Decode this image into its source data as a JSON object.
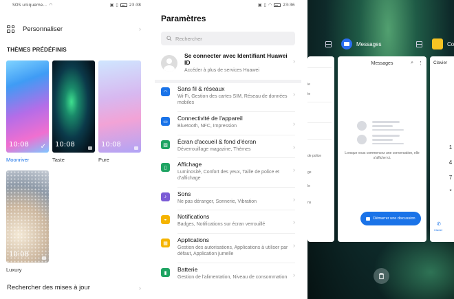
{
  "panel1": {
    "statusbar": {
      "left": "SOS uniqueme...",
      "time": "23:38"
    },
    "personalize_label": "Personnaliser",
    "themes_title": "THÈMES PRÉDÉFINIS",
    "themes": [
      {
        "name": "Moonriver",
        "clock": "10:08",
        "selected": true,
        "name_color": "#1a73e8"
      },
      {
        "name": "Taste",
        "clock": "10:08"
      },
      {
        "name": "Pure",
        "clock": "10:08"
      },
      {
        "name": "Luxury",
        "clock": "10:08"
      }
    ],
    "updates_label": "Rechercher des mises à jour"
  },
  "panel2": {
    "statusbar_time": "23:36",
    "title": "Paramètres",
    "search_placeholder": "Rechercher",
    "account": {
      "title": "Se connecter avec Identifiant Huawei ID",
      "subtitle": "Accéder à plus de services Huawei"
    },
    "items": [
      {
        "title": "Sans fil & réseaux",
        "subtitle": "Wi-Fi, Gestion des cartes SIM, Réseau de données mobiles",
        "color": "#1a73e8",
        "icon": "wifi-icon"
      },
      {
        "title": "Connectivité de l'appareil",
        "subtitle": "Bluetooth, NFC, Impression",
        "color": "#1a73e8",
        "icon": "device-connect-icon"
      },
      {
        "title": "Écran d'accueil & fond d'écran",
        "subtitle": "Déverrouillage magazine, Thèmes",
        "color": "#1fa463",
        "icon": "wallpaper-icon"
      },
      {
        "title": "Affichage",
        "subtitle": "Luminosité, Confort des yeux, Taille de police et d'affichage",
        "color": "#1fa463",
        "icon": "display-icon"
      },
      {
        "title": "Sons",
        "subtitle": "Ne pas déranger, Sonnerie, Vibration",
        "color": "#7b5cd6",
        "icon": "sound-icon"
      },
      {
        "title": "Notifications",
        "subtitle": "Badges, Notifications sur écran verrouillé",
        "color": "#f5b400",
        "icon": "bell-icon"
      },
      {
        "title": "Applications",
        "subtitle": "Gestion des autorisations, Applications à utiliser par défaut, Application jumelle",
        "color": "#f5b400",
        "icon": "apps-icon"
      },
      {
        "title": "Batterie",
        "subtitle": "Gestion de l'alimentation, Niveau de consommation",
        "color": "#1fa463",
        "icon": "battery-icon"
      }
    ]
  },
  "panel3": {
    "app1_label": "Messages",
    "app2_label": "Co",
    "card_main_title": "Messages",
    "empty_text": "Lorsque vous commencez une conversation, elle s'affiche ici.",
    "start_button": "Démarrer une discussion",
    "card_right_title": "Clavier",
    "card_right_footer": "Clavier",
    "keys": [
      "1",
      "4",
      "7",
      "*"
    ],
    "left_card_items": [
      "ie",
      "te",
      "de police",
      "ge",
      "le",
      "ns"
    ]
  }
}
